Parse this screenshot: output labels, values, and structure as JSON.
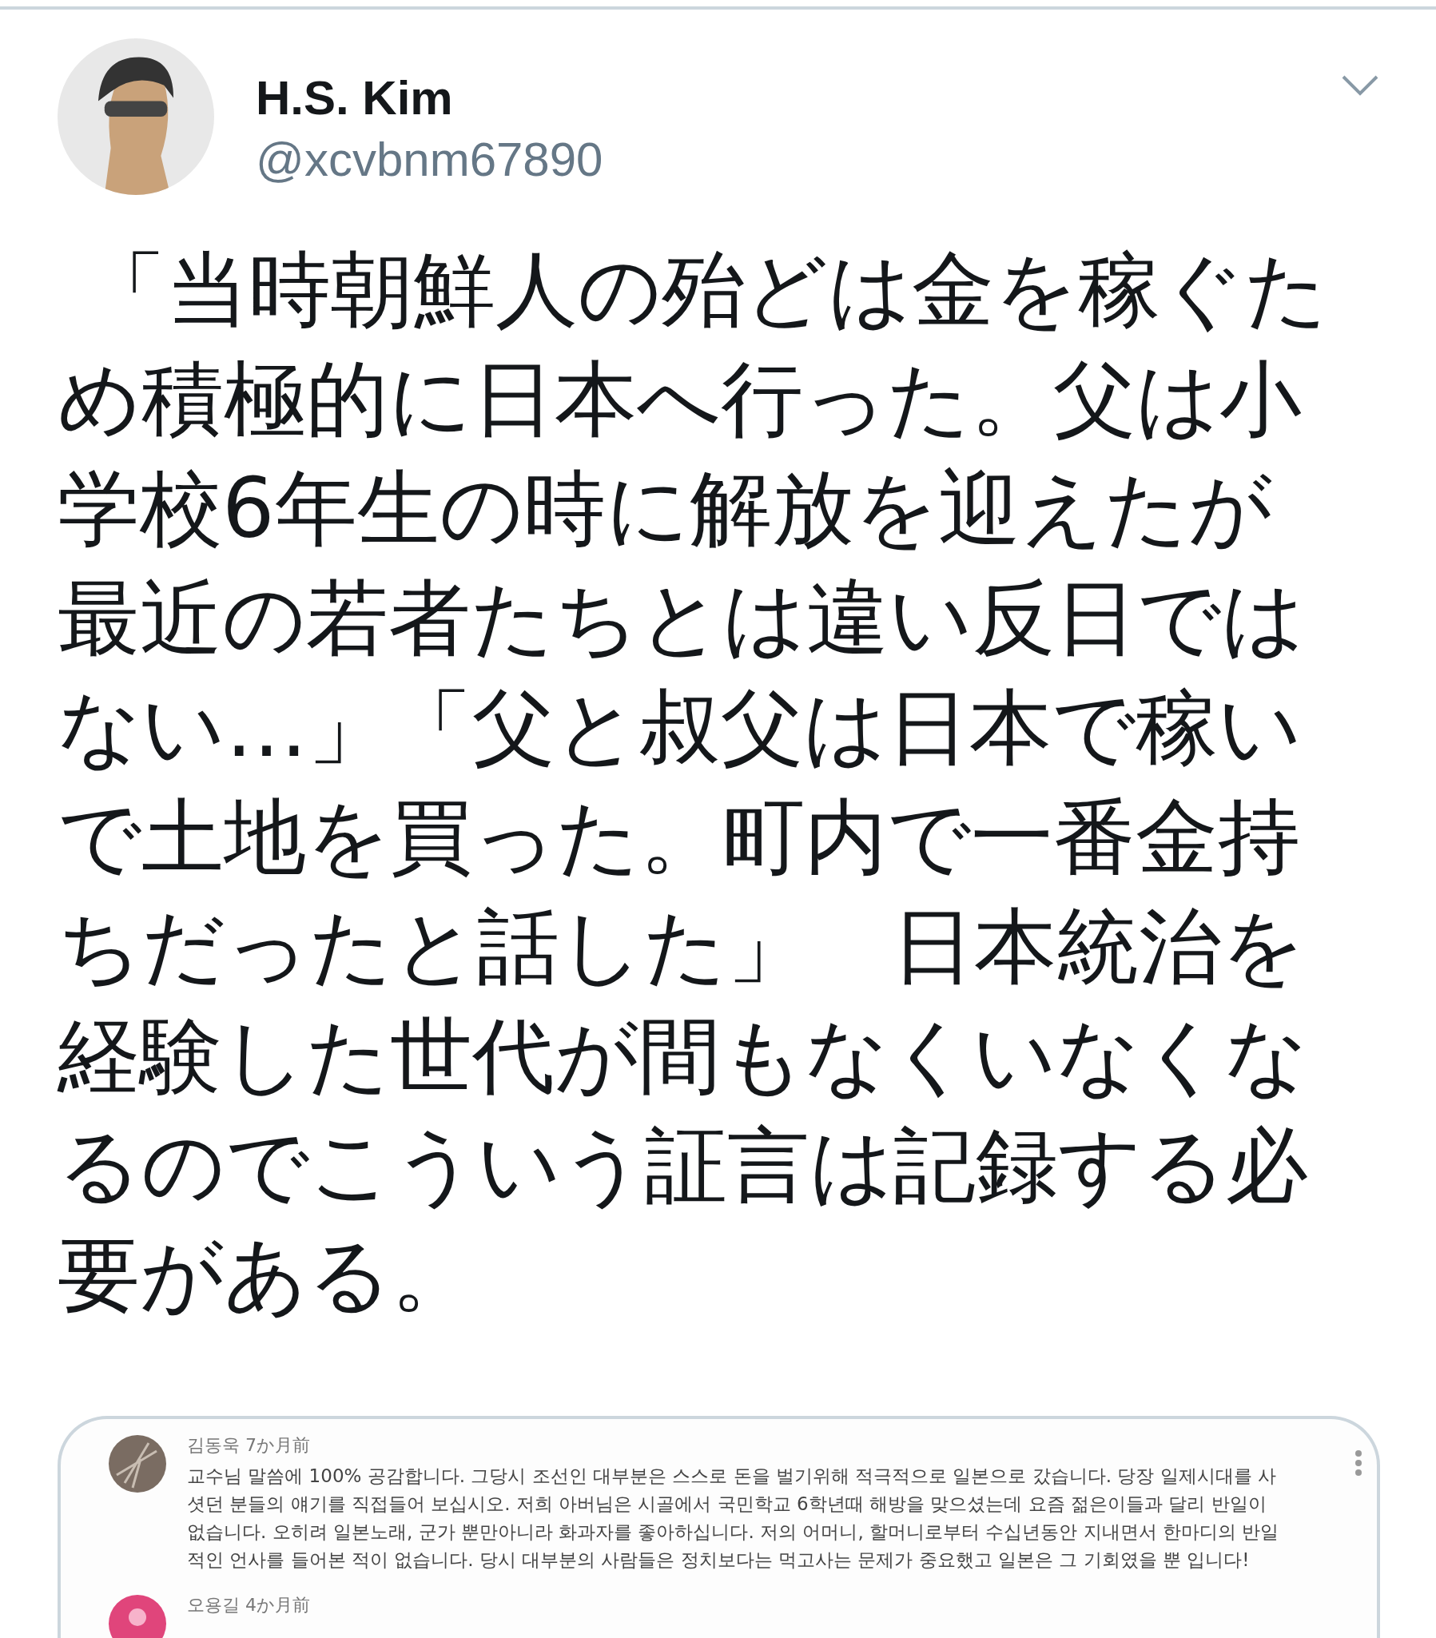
{
  "author": {
    "name": "H.S. Kim",
    "handle": "@xcvbnm67890"
  },
  "tweet_text": " 「当時朝鮮人の殆どは金を稼ぐため積極的に日本へ行った。父は小学校6年生の時に解放を迎えたが最近の若者たちとは違い反日ではない…」「父と叔父は日本で稼いで土地を買った。町内で一番金持ちだったと話した」　日本統治を経験した世代が間もなくいなくなるのでこういう証言は記録する必要がある。",
  "attached_image": {
    "comments": [
      {
        "author": "김동욱",
        "time": "7か月前",
        "text": "교수님 말씀에 100% 공감합니다. 그당시 조선인 대부분은 스스로 돈을 벌기위해 적극적으로 일본으로 갔습니다. 당장 일제시대를 사셧던 분들의 얘기를 직접들어 보십시오. 저희 아버님은 시골에서 국민학교 6학년때 해방을 맞으셨는데 요즘 젊은이들과 달리 반일이 없습니다. 오히려 일본노래, 군가 뿐만아니라 화과자를 좋아하십니다. 저의 어머니, 할머니로부터 수십년동안 지내면서 한마디의 반일적인 언사를 들어본 적이 없습니다. 당시 대부분의 사람들은 정치보다는 먹고사는 문제가 중요했고 일본은 그 기회였을 뿐 입니다!",
        "kind": "photo"
      },
      {
        "author": "오용길",
        "time": "4か月前",
        "kind": "plain"
      }
    ]
  }
}
